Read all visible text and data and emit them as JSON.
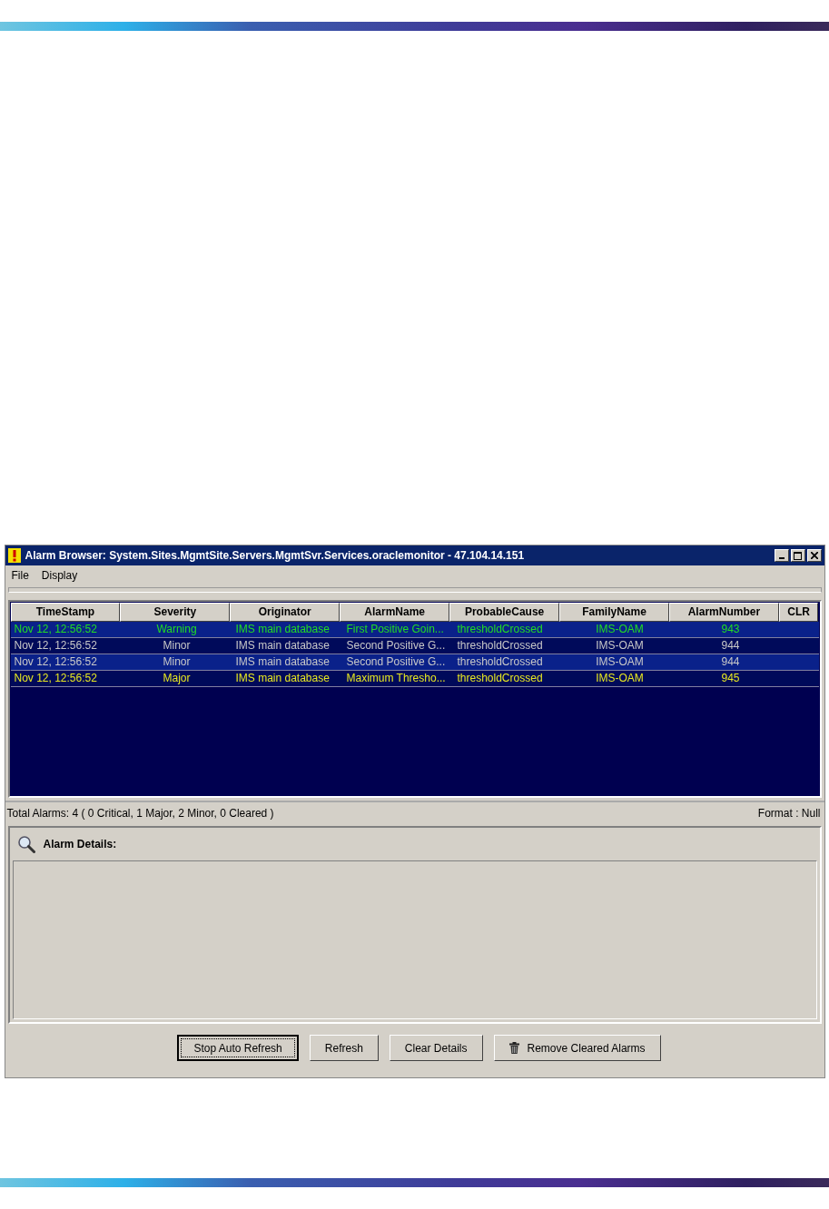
{
  "window": {
    "title": "Alarm Browser: System.Sites.MgmtSite.Servers.MgmtSvr.Services.oraclemonitor - 47.104.14.151"
  },
  "menu": [
    "File",
    "Display"
  ],
  "table": {
    "columns": [
      "TimeStamp",
      "Severity",
      "Originator",
      "AlarmName",
      "ProbableCause",
      "FamilyName",
      "AlarmNumber",
      "CLR"
    ],
    "rows": [
      {
        "selected": true,
        "kind": "warning",
        "cells": [
          "Nov 12, 12:56:52",
          "Warning",
          "IMS main database",
          "First Positive Goin...",
          "thresholdCrossed",
          "IMS-OAM",
          "943"
        ]
      },
      {
        "selected": false,
        "kind": "minor",
        "cells": [
          "Nov 12, 12:56:52",
          "Minor",
          "IMS main database",
          "Second Positive G...",
          "thresholdCrossed",
          "IMS-OAM",
          "944"
        ]
      },
      {
        "selected": true,
        "kind": "minor",
        "cells": [
          "Nov 12, 12:56:52",
          "Minor",
          "IMS main database",
          "Second Positive G...",
          "thresholdCrossed",
          "IMS-OAM",
          "944"
        ]
      },
      {
        "selected": false,
        "kind": "major",
        "cells": [
          "Nov 12, 12:56:52",
          "Major",
          "IMS main database",
          "Maximum Thresho...",
          "thresholdCrossed",
          "IMS-OAM",
          "945"
        ]
      }
    ]
  },
  "status_bar": {
    "summary": "Total Alarms: 4 ( 0 Critical, 1 Major, 2 Minor, 0 Cleared )",
    "format": "Format : Null"
  },
  "details": {
    "title": "Alarm Details:"
  },
  "buttons": [
    {
      "label": "Stop Auto Refresh",
      "focused": true,
      "kind": "plain"
    },
    {
      "label": "Refresh",
      "focused": false,
      "kind": "plain"
    },
    {
      "label": "Clear Details",
      "focused": false,
      "kind": "plain"
    },
    {
      "label": "Remove Cleared Alarms",
      "focused": false,
      "kind": "trash"
    }
  ]
}
